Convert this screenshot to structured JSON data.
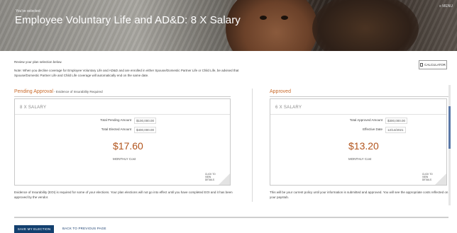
{
  "header": {
    "kicker": "You've selected",
    "title": "Employee Voluntary Life and AD&D: 8 X Salary",
    "menu_label": "MENU"
  },
  "intro": {
    "review": "Review your plan selection below.",
    "note": "Note: When you decline coverage for Employee Voluntary Life and AD&D and are enrolled in either Spouse/Domestic Partner Life or Child Life, be advised that Spouse/Domestic Partner Life and Child Life coverage will automatically end on the same date."
  },
  "calculator_label": "CALCULATOR",
  "pending": {
    "title": "Pending Approval",
    "subtitle": " - Evidence of Insurability Required",
    "plan": "8 X SALARY",
    "rows": [
      {
        "label": "Total Pending Amount",
        "value": "$100,000.00"
      },
      {
        "label": "Total Elected Amount",
        "value": "$400,000.00"
      }
    ],
    "cost": "$17.60",
    "cost_label": "MONTHLY Cost",
    "details": [
      "CLICK TO",
      "VIEW",
      "DETAILS"
    ],
    "footnote": "Evidence of Insurability (EOI) is required for some of your elections. Your plan elections will not go into effect until you have completed EOI and it has been approved by the vendor."
  },
  "approved": {
    "title": "Approved",
    "plan": "6 X SALARY",
    "rows": [
      {
        "label": "Total Approved Amount",
        "value": "$300,000.00"
      },
      {
        "label": "Effective Date",
        "value": "12/14/2021"
      }
    ],
    "cost": "$13.20",
    "cost_label": "MONTHLY Cost",
    "details": [
      "CLICK TO",
      "VIEW",
      "DETAILS"
    ],
    "footnote": "This will be your current policy until your information is submitted and approved. You will see the appropriate costs reflected on your paystub."
  },
  "actions": {
    "save": "SAVE MY ELECTION",
    "back": "BACK TO PREVIOUS PAGE"
  }
}
